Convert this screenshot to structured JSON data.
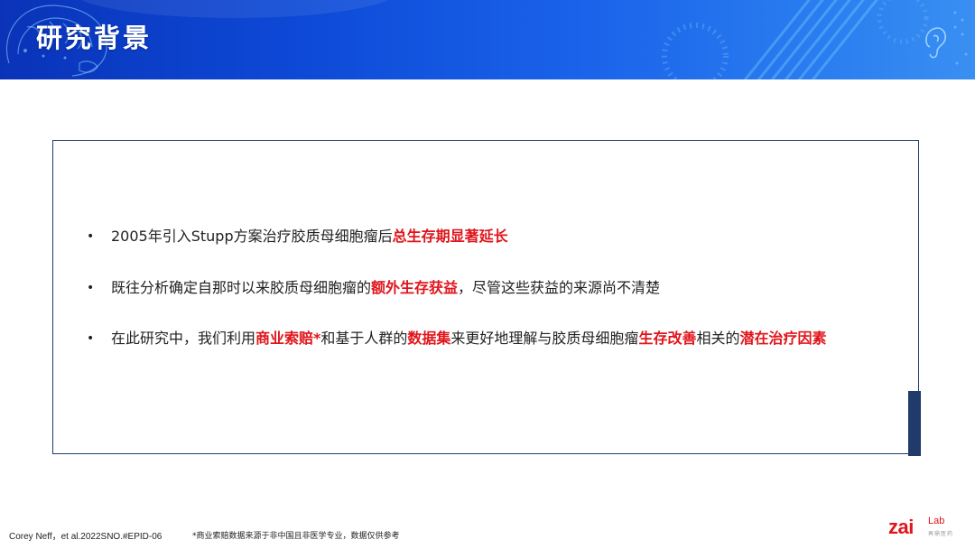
{
  "header": {
    "title": "研究背景"
  },
  "bullets": [
    {
      "segments": [
        {
          "text": "2005年引入Stupp方案治疗胶质母细胞瘤后",
          "highlight": false
        },
        {
          "text": "总生存期显著延长",
          "highlight": true
        }
      ]
    },
    {
      "segments": [
        {
          "text": "既往分析确定自那时以来胶质母细胞瘤的",
          "highlight": false
        },
        {
          "text": "额外生存获益",
          "highlight": true
        },
        {
          "text": "，尽管这些获益的来源尚不清楚",
          "highlight": false
        }
      ]
    },
    {
      "segments": [
        {
          "text": "在此研究中，我们利用",
          "highlight": false
        },
        {
          "text": "商业索赔*",
          "highlight": true
        },
        {
          "text": "和基于人群的",
          "highlight": false
        },
        {
          "text": "数据集",
          "highlight": true
        },
        {
          "text": "来更好地理解与胶质母细胞瘤",
          "highlight": false
        },
        {
          "text": "生存改善",
          "highlight": true
        },
        {
          "text": "相关的",
          "highlight": false
        },
        {
          "text": "潜在治疗因素",
          "highlight": true
        }
      ]
    }
  ],
  "bullet_symbol": "•",
  "footer": {
    "citation": "Corey Neff，et al.2022SNO.#EPID-06",
    "note": "*商业索赔数据来源于非中国且非医学专业，数据仅供参考"
  },
  "logo": {
    "main": "zai",
    "sup": "Lab",
    "cn": "再鼎医药"
  },
  "colors": {
    "highlight": "#e0141b",
    "banner": "#0d49d6",
    "box_border": "#1f3a6b"
  },
  "icons": [
    "brain-icon",
    "ear-icon"
  ]
}
